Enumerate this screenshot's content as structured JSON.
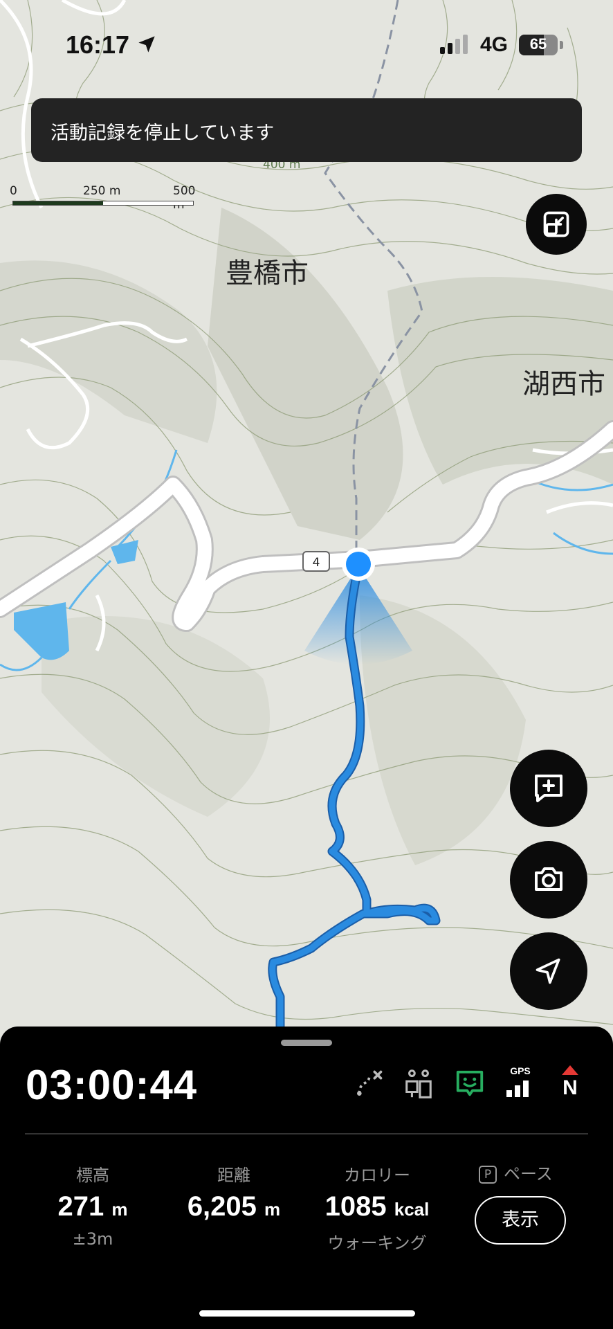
{
  "status_bar": {
    "time": "16:17",
    "network": "4G",
    "battery": "65"
  },
  "toast": {
    "message": "活動記録を停止しています"
  },
  "map": {
    "scale": {
      "label_0": "0",
      "label_mid": "250 m",
      "label_max": "500 m"
    },
    "contour_label": "400 m",
    "cities": [
      {
        "name": "豊橋市"
      },
      {
        "name": "湖西市"
      }
    ],
    "road_number": "4",
    "colors": {
      "track": "#2a8be0",
      "position": "#1e90ff",
      "water": "#5fb6ec"
    }
  },
  "fabs": {
    "layers_icon": "layers-icon",
    "note_icon": "add-note-icon",
    "camera_icon": "camera-icon",
    "locate_icon": "locate-arrow-icon"
  },
  "panel": {
    "elapsed": "03:00:44",
    "status_icons": [
      "route-off-icon",
      "companion-icon",
      "face-status-icon",
      "gps-signal-icon",
      "compass-north-icon"
    ],
    "gps_label": "GPS",
    "north_label": "N",
    "stats": {
      "elevation": {
        "label": "標高",
        "value": "271",
        "unit": "m",
        "sub": "±3m"
      },
      "distance": {
        "label": "距離",
        "value": "6,205",
        "unit": "m"
      },
      "calories": {
        "label": "カロリー",
        "value": "1085",
        "unit": "kcal",
        "sub": "ウォーキング"
      },
      "pace": {
        "badge": "P",
        "label": "ペース",
        "button": "表示"
      }
    }
  }
}
